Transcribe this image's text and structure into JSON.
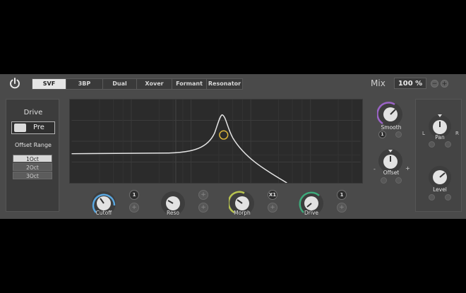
{
  "header": {
    "tabs": [
      {
        "label": "SVF",
        "active": true
      },
      {
        "label": "3BP",
        "active": false
      },
      {
        "label": "Dual",
        "active": false
      },
      {
        "label": "Xover",
        "active": false
      },
      {
        "label": "Formant",
        "active": false
      },
      {
        "label": "Resonator",
        "active": false
      }
    ],
    "mix_label": "Mix",
    "mix_value": "100 %"
  },
  "left_panel": {
    "drive_label": "Drive",
    "drive_mode": "Pre",
    "offset_range_label": "Offset Range",
    "offset_options": [
      {
        "label": "1Oct",
        "selected": true
      },
      {
        "label": "2Oct",
        "selected": false
      },
      {
        "label": "3Oct",
        "selected": false
      }
    ]
  },
  "knobs": {
    "cutoff": {
      "label": "Cutoff",
      "ring": "#5aa7e0",
      "badge": "1"
    },
    "reso": {
      "label": "Reso"
    },
    "morph": {
      "label": "Morph",
      "ring": "#b8c44f",
      "badge": "X1"
    },
    "drive": {
      "label": "Drive",
      "ring": "#3ea97b",
      "badge": "1"
    },
    "smooth": {
      "label": "Smooth",
      "ring": "#9b63c7",
      "badge": "1"
    },
    "offset": {
      "label": "Offset",
      "minus": "-",
      "plus": "+"
    },
    "pan": {
      "label": "Pan",
      "left": "L",
      "right": "R"
    },
    "level": {
      "label": "Level"
    }
  },
  "colors": {
    "panel": "#4a4a4a",
    "graph_bg": "#2b2b2b",
    "curve": "#e6e6e6",
    "handle": "#d9b43b"
  }
}
